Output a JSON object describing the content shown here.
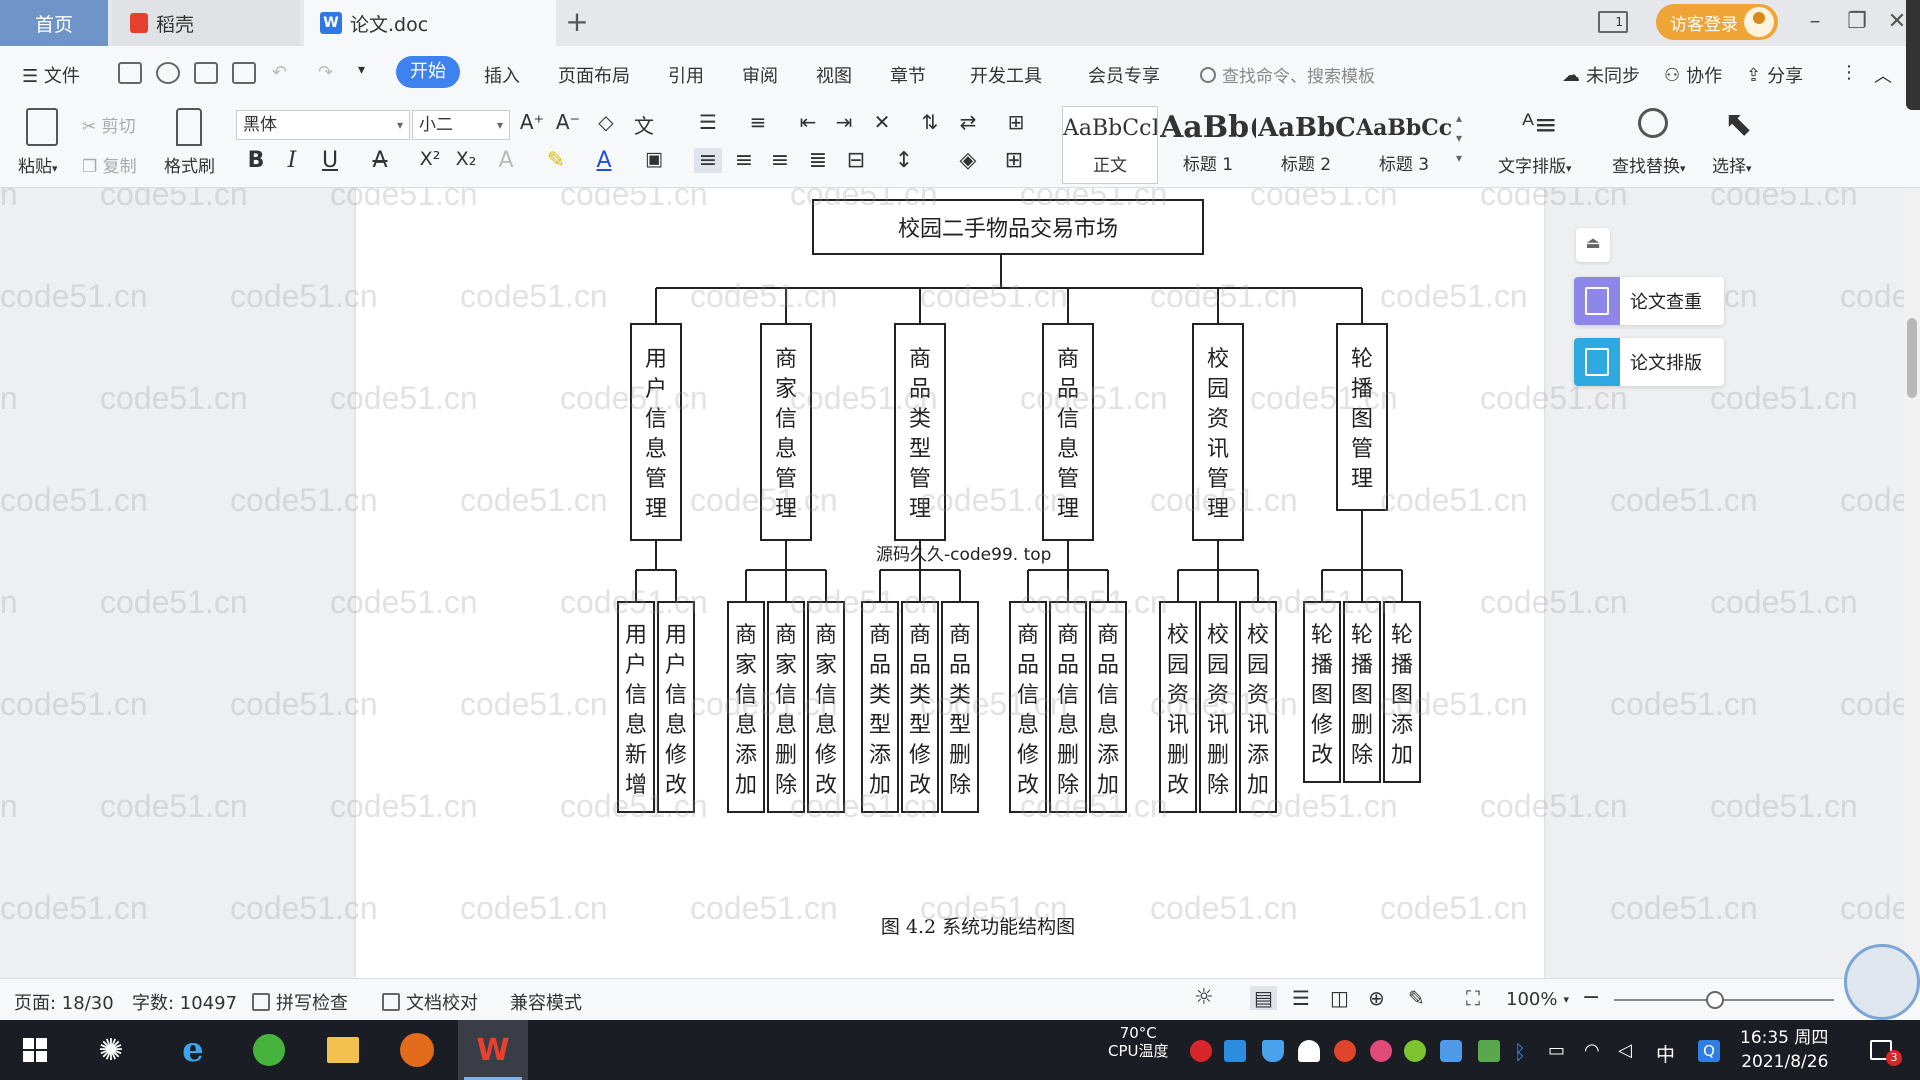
{
  "tabs": {
    "home": "首页",
    "docer": "稻壳",
    "document": "论文.doc"
  },
  "topbar": {
    "login": "访客登录"
  },
  "menu": {
    "file": "文件",
    "start": "开始",
    "items": [
      "插入",
      "页面布局",
      "引用",
      "审阅",
      "视图",
      "章节",
      "开发工具",
      "会员专享"
    ],
    "search_placeholder": "查找命令、搜索模板",
    "sync": "未同步",
    "collab": "协作",
    "share": "分享"
  },
  "ribbon": {
    "paste": "粘贴",
    "cut": "剪切",
    "copy": "复制",
    "format_painter": "格式刷",
    "font_name": "黑体",
    "font_size": "小二",
    "styles": [
      {
        "sample": "AaBbCcI",
        "name": "正文"
      },
      {
        "sample": "AaBb(",
        "name": "标题 1"
      },
      {
        "sample": "AaBbC",
        "name": "标题 2"
      },
      {
        "sample": "AaBbCcl",
        "name": "标题 3"
      }
    ],
    "text_layout": "文字排版",
    "find_replace": "查找替换",
    "select": "选择"
  },
  "diagram": {
    "root": "校园二手物品交易市场",
    "modules": [
      {
        "name": "用户信息管理",
        "children": [
          "用户信息新增",
          "用户信息修改"
        ]
      },
      {
        "name": "商家信息管理",
        "children": [
          "商家信息添加",
          "商家信息删除",
          "商家信息修改"
        ]
      },
      {
        "name": "商品类型管理",
        "children": [
          "商品类型添加",
          "商品类型修改",
          "商品类型删除"
        ]
      },
      {
        "name": "商品信息管理",
        "children": [
          "商品信息修改",
          "商品信息删除",
          "商品信息添加"
        ]
      },
      {
        "name": "校园资讯管理",
        "children": [
          "校园资讯删改",
          "校园资讯删除",
          "校园资讯添加"
        ]
      },
      {
        "name": "轮播图管理",
        "children": [
          "轮播图修改",
          "轮播图删除",
          "轮播图添加"
        ]
      }
    ],
    "caption": "图 4.2  系统功能结构图",
    "overlay": "源码久久-code99. top"
  },
  "side_panel": {
    "check": "论文查重",
    "layout": "论文排版"
  },
  "watermark": "code51.cn",
  "status": {
    "page": "页面: 18/30",
    "words": "字数: 10497",
    "spell": "拼写检查",
    "proof": "文档校对",
    "compat": "兼容模式",
    "zoom": "100%"
  },
  "taskbar": {
    "cpu_temp": "70°C",
    "cpu_label": "CPU温度",
    "ime": "中",
    "time": "16:35 周四",
    "date": "2021/8/26",
    "notif_count": "3"
  },
  "colors": {
    "accent": "#3d82ee",
    "home_tab": "#6f95c8",
    "login": "#f0a436",
    "check_icon": "#8e86e8",
    "layout_icon": "#2fa9e0"
  }
}
